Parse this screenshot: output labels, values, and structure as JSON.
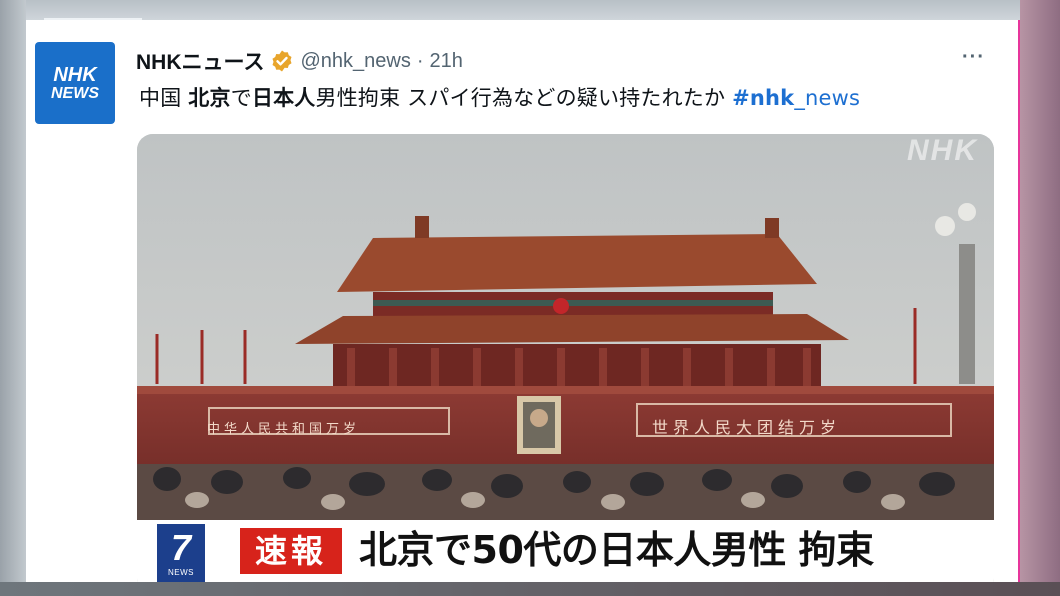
{
  "tweet": {
    "author_name": "NHKニュース",
    "handle": "@nhk_news",
    "separator": "·",
    "time": "21h",
    "more_label": "···",
    "avatar": {
      "line1": "NHK",
      "line2": "NEWS"
    },
    "text": {
      "p1": "中国 ",
      "p2": "北京",
      "p3": "で",
      "p4": "日本人",
      "p5": "男性拘束 スパイ行為などの疑い持たれたか ",
      "hashtag_bold": "#nhk",
      "hashtag_rest": "_news"
    }
  },
  "media": {
    "watermark": "NHK",
    "banner_left": "中华人民共和国万岁",
    "banner_right": "世界人民大团结万岁",
    "program_logo_number": "7",
    "program_logo_label": "NEWS",
    "flash_label": "速報",
    "headline": "北京で50代の日本人男性 拘束"
  },
  "colors": {
    "avatar_bg": "#1a6fc9",
    "hashtag": "#1d6fd1",
    "flash_bg": "#d7231b",
    "verified": "#e8a52c"
  }
}
